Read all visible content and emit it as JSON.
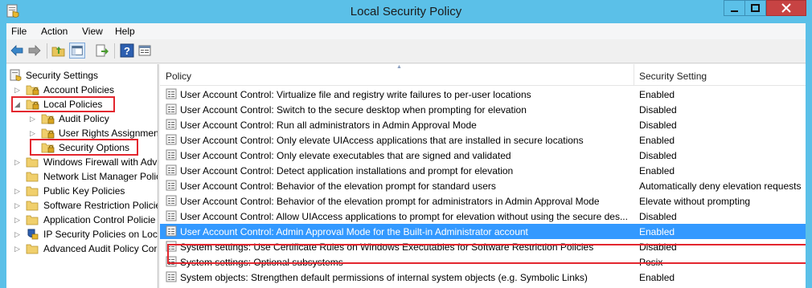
{
  "window": {
    "title": "Local Security Policy"
  },
  "menu": [
    "File",
    "Action",
    "View",
    "Help"
  ],
  "toolbar": {
    "buttons": [
      "back-icon",
      "forward-icon",
      "up-folder-icon",
      "show-hide-tree-icon",
      "export-list-icon",
      "help-icon",
      "properties-icon"
    ]
  },
  "tree": {
    "root": "Security Settings",
    "items": [
      {
        "label": "Account Policies"
      },
      {
        "label": "Local Policies"
      },
      {
        "label": "Audit Policy"
      },
      {
        "label": "User Rights Assignment"
      },
      {
        "label": "Security Options"
      },
      {
        "label": "Windows Firewall with Adv"
      },
      {
        "label": "Network List Manager Polic"
      },
      {
        "label": "Public Key Policies"
      },
      {
        "label": "Software Restriction Policie"
      },
      {
        "label": "Application Control Policie"
      },
      {
        "label": "IP Security Policies on Loca"
      },
      {
        "label": "Advanced Audit Policy Cor"
      }
    ]
  },
  "list": {
    "columns": {
      "policy": "Policy",
      "setting": "Security Setting"
    },
    "rows": [
      {
        "policy": "User Account Control: Virtualize file and registry write failures to per-user locations",
        "setting": "Enabled"
      },
      {
        "policy": "User Account Control: Switch to the secure desktop when prompting for elevation",
        "setting": "Disabled"
      },
      {
        "policy": "User Account Control: Run all administrators in Admin Approval Mode",
        "setting": "Disabled"
      },
      {
        "policy": "User Account Control: Only elevate UIAccess applications that are installed in secure locations",
        "setting": "Enabled"
      },
      {
        "policy": "User Account Control: Only elevate executables that are signed and validated",
        "setting": "Disabled"
      },
      {
        "policy": "User Account Control: Detect application installations and prompt for elevation",
        "setting": "Enabled"
      },
      {
        "policy": "User Account Control: Behavior of the elevation prompt for standard users",
        "setting": "Automatically deny elevation requests"
      },
      {
        "policy": "User Account Control: Behavior of the elevation prompt for administrators in Admin Approval Mode",
        "setting": "Elevate without prompting"
      },
      {
        "policy": "User Account Control: Allow UIAccess applications to prompt for elevation without using the secure des...",
        "setting": "Disabled"
      },
      {
        "policy": "User Account Control: Admin Approval Mode for the Built-in Administrator account",
        "setting": "Enabled"
      },
      {
        "policy": "System settings: Use Certificate Rules on Windows Executables for Software Restriction Policies",
        "setting": "Disabled"
      },
      {
        "policy": "System settings: Optional subsystems",
        "setting": "Posix"
      },
      {
        "policy": "System objects: Strengthen default permissions of internal system objects (e.g. Symbolic Links)",
        "setting": "Enabled"
      }
    ]
  },
  "colors": {
    "titlebar": "#5bc0e8",
    "selection": "#3399ff",
    "highlight_box": "#e3262e"
  }
}
